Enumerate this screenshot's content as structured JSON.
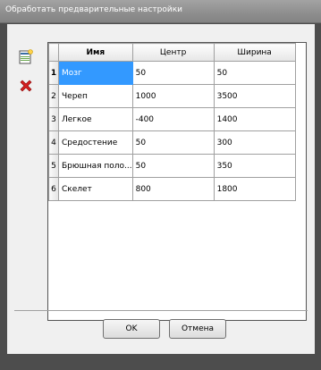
{
  "window": {
    "title": "Обработать предварительные настройки"
  },
  "toolbar": {
    "add_icon": "add-row-icon",
    "delete_icon": "delete-row-icon"
  },
  "table": {
    "headers": {
      "row": "",
      "name": "Имя",
      "center": "Центр",
      "width": "Ширина"
    },
    "rows": [
      {
        "num": "1",
        "name": "Мозг",
        "center": "50",
        "width": "50"
      },
      {
        "num": "2",
        "name": "Череп",
        "center": "1000",
        "width": "3500"
      },
      {
        "num": "3",
        "name": "Легкое",
        "center": "-400",
        "width": "1400"
      },
      {
        "num": "4",
        "name": "Средостение",
        "center": "50",
        "width": "300"
      },
      {
        "num": "5",
        "name": "Брюшная поло...",
        "center": "50",
        "width": "350"
      },
      {
        "num": "6",
        "name": "Скелет",
        "center": "800",
        "width": "1800"
      }
    ]
  },
  "buttons": {
    "ok": "OK",
    "cancel": "Отмена"
  },
  "colors": {
    "selection": "#3399ff"
  }
}
